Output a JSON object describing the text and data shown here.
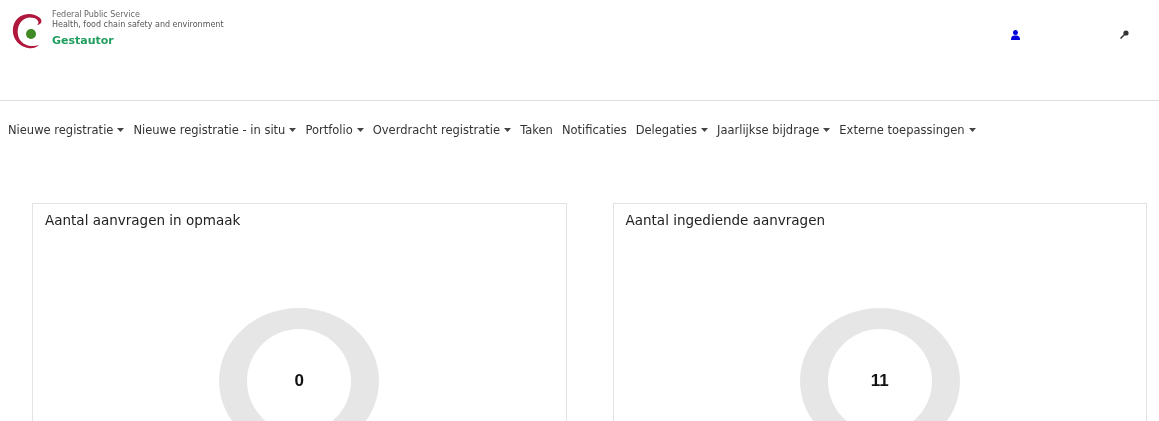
{
  "header": {
    "agency": "Federal Public Service",
    "department": "Health, food chain safety and environment",
    "app_name": "Gestautor"
  },
  "nav": [
    {
      "label": "Nieuwe registratie",
      "has_menu": true
    },
    {
      "label": "Nieuwe registratie - in situ",
      "has_menu": true
    },
    {
      "label": "Portfolio",
      "has_menu": true
    },
    {
      "label": "Overdracht registratie",
      "has_menu": true
    },
    {
      "label": "Taken",
      "has_menu": false
    },
    {
      "label": "Notificaties",
      "has_menu": false
    },
    {
      "label": "Delegaties",
      "has_menu": true
    },
    {
      "label": "Jaarlijkse bijdrage",
      "has_menu": true
    },
    {
      "label": "Externe toepassingen",
      "has_menu": true
    }
  ],
  "cards": [
    {
      "title": "Aantal aanvragen in opmaak",
      "count": "0"
    },
    {
      "title": "Aantal ingediende aanvragen",
      "count": "11"
    }
  ]
}
